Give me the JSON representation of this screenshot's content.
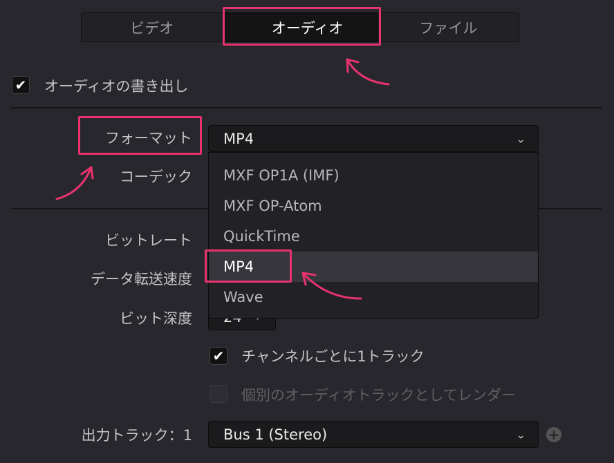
{
  "tabs": [
    {
      "label": "ビデオ"
    },
    {
      "label": "オーディオ",
      "selected": true
    },
    {
      "label": "ファイル"
    }
  ],
  "export_audio": {
    "label": "オーディオの書き出し",
    "checked": true
  },
  "format": {
    "label": "フォーマット",
    "value": "MP4",
    "options": [
      "MXF OP1A (IMF)",
      "MXF OP-Atom",
      "QuickTime",
      "MP4",
      "Wave"
    ],
    "highlighted": "MP4"
  },
  "codec": {
    "label": "コーデック"
  },
  "bitrate": {
    "label": "ビットレート"
  },
  "data_rate": {
    "label": "データ転送速度"
  },
  "bit_depth": {
    "label": "ビット深度",
    "value": "24"
  },
  "one_track_per_channel": {
    "label": "チャンネルごとに1トラック",
    "checked": true
  },
  "render_separate": {
    "label": "個別のオーディオトラックとしてレンダー",
    "checked": false,
    "disabled": true
  },
  "output_track": {
    "label": "出力トラック：1",
    "value": "Bus 1 (Stereo)"
  },
  "colors": {
    "annotation": "#e8336d",
    "background": "#28272d"
  }
}
